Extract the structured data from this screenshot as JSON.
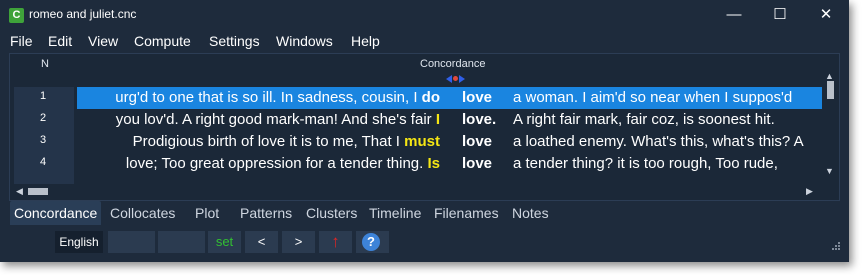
{
  "window": {
    "title": "romeo and juliet.cnc",
    "controls": {
      "minimize": "—",
      "maximize": "☐",
      "close": "✕"
    }
  },
  "menu": [
    "File",
    "Edit",
    "View",
    "Compute",
    "Settings",
    "Windows",
    "Help"
  ],
  "table": {
    "col_n": "N",
    "col_concordance": "Concordance",
    "rows": [
      {
        "n": "1",
        "left": "urg'd to one that is so ill. In sadness, cousin, I",
        "context": "do",
        "keyword": "love",
        "right": "a woman. I aim'd so near when I suppos'd",
        "selected": true
      },
      {
        "n": "2",
        "left": "you lov'd. A right good mark-man! And she's fair",
        "context": "I",
        "keyword": "love.",
        "right": "A right fair mark, fair coz, is soonest hit.",
        "selected": false
      },
      {
        "n": "3",
        "left": "Prodigious birth of love it is to me, That I",
        "context": "must",
        "keyword": "love",
        "right": "a loathed enemy. What's this, what's this? A",
        "selected": false
      },
      {
        "n": "4",
        "left": "love; Too great oppression for a tender thing.",
        "context": "Is",
        "keyword": "love",
        "right": "a tender thing? it is too rough, Too rude,",
        "selected": false
      }
    ]
  },
  "tabs": [
    "Concordance",
    "Collocates",
    "Plot",
    "Patterns",
    "Clusters",
    "Timeline",
    "Filenames",
    "Notes"
  ],
  "toolbar": {
    "language": "English",
    "set_label": "set",
    "prev_label": "<",
    "next_label": ">",
    "up_label": "↑",
    "help_label": "?"
  }
}
